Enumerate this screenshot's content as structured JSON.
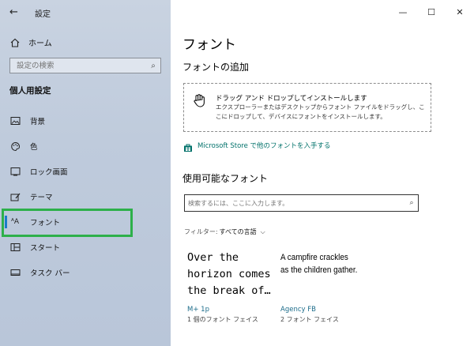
{
  "window": {
    "title": "設定",
    "controls": {
      "minimize": "—",
      "maximize": "☐",
      "close": "✕"
    }
  },
  "sidebar": {
    "back_icon": "←",
    "home_label": "ホーム",
    "search_placeholder": "設定の検索",
    "section_title": "個人用設定",
    "items": [
      {
        "label": "背景",
        "icon": "picture-icon"
      },
      {
        "label": "色",
        "icon": "palette-icon"
      },
      {
        "label": "ロック画面",
        "icon": "lock-screen-icon"
      },
      {
        "label": "テーマ",
        "icon": "brush-icon"
      },
      {
        "label": "フォント",
        "icon": "font-icon",
        "selected": true
      },
      {
        "label": "スタート",
        "icon": "start-icon"
      },
      {
        "label": "タスク バー",
        "icon": "taskbar-icon"
      }
    ]
  },
  "main": {
    "title": "フォント",
    "add_title": "フォントの追加",
    "drop_heading": "ドラッグ アンド ドロップしてインストールします",
    "drop_desc": "エクスプローラーまたはデスクトップからフォント ファイルをドラッグし、ここにドロップして、デバイスにフォントをインストールします。",
    "store_link": "Microsoft Store で他のフォントを入手する",
    "available_title": "使用可能なフォント",
    "search_placeholder": "検索するには、ここに入力します。",
    "filter_label": "フィルター:",
    "filter_value": "すべての言語",
    "fonts": [
      {
        "sample": "Over the horizon comes the break of…",
        "name": "M+ 1p",
        "count": "1 個のフォント フェイス"
      },
      {
        "sample": "A campfire crackles as the children gather.",
        "name": "Agency FB",
        "count": "2 フォント フェイス"
      }
    ]
  },
  "colors": {
    "accent": "#1a7cc9",
    "link": "#00716a",
    "highlight": "#2db04a"
  }
}
